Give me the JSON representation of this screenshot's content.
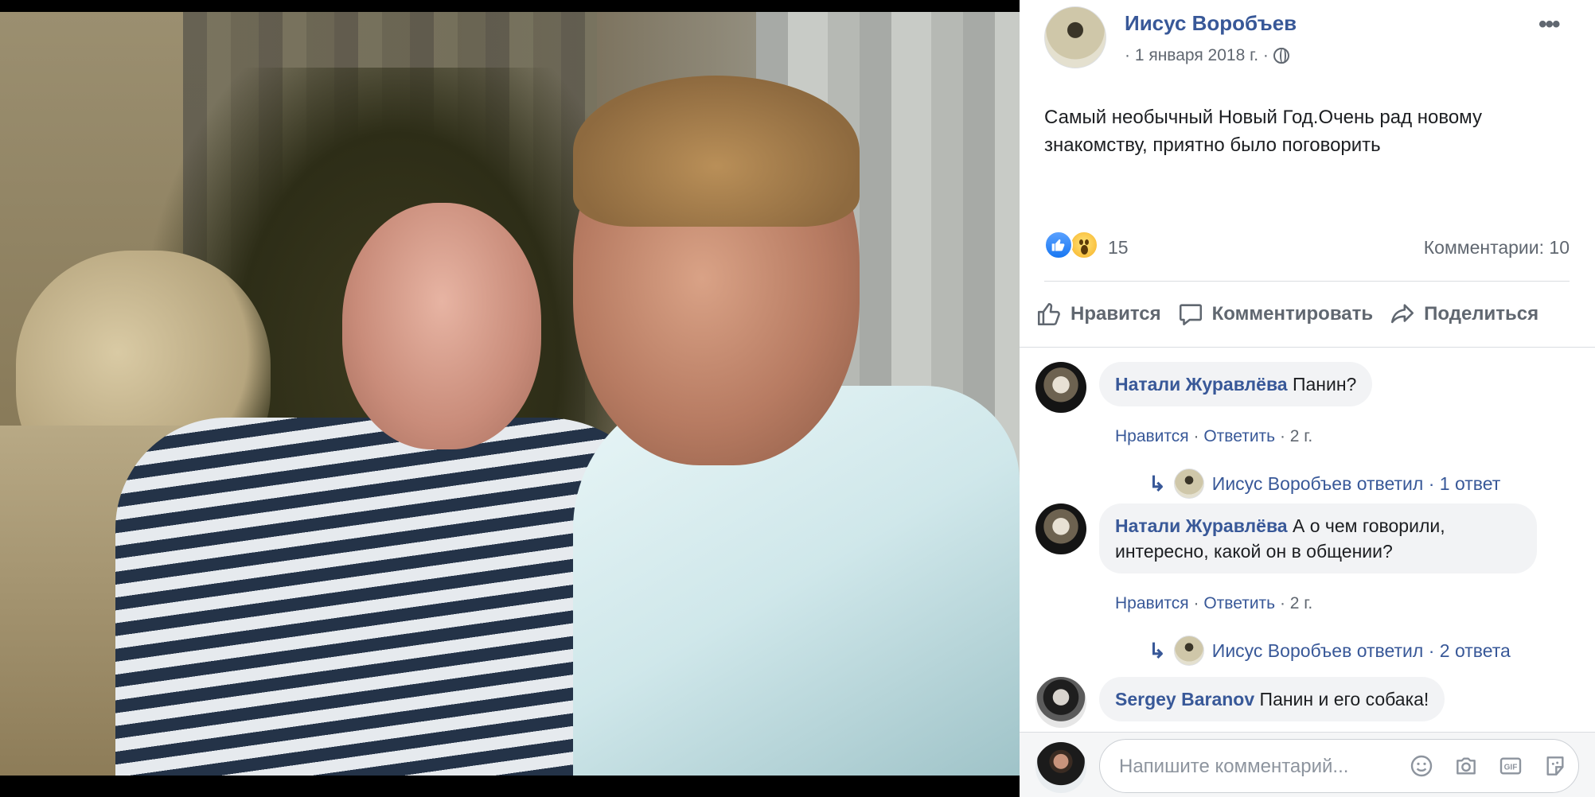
{
  "post": {
    "author": "Иисус Воробъев",
    "date": "· 1 января 2018 г. ·",
    "text": "Самый необычный Новый Год.Очень рад новому знакомству, приятно было поговорить",
    "reactions_count": "15",
    "comments_count": "Комментарии: 10",
    "more_label": "•••"
  },
  "actions": {
    "like": "Нравится",
    "comment": "Комментировать",
    "share": "Поделиться"
  },
  "comments": [
    {
      "author": "Натали Журавлёва",
      "text": "Панин?",
      "like": "Нравится",
      "reply": "Ответить",
      "time": "2 г.",
      "replies_link": "Иисус Воробъев ответил · 1 ответ"
    },
    {
      "author": "Натали Журавлёва",
      "text": "А о чем говорили,",
      "text2": "интересно, какой он в общении?",
      "like": "Нравится",
      "reply": "Ответить",
      "time": "2 г.",
      "replies_link": "Иисус Воробъев ответил · 2 ответа"
    },
    {
      "author": "Sergey Baranov",
      "text": "Панин и его собака!"
    }
  ],
  "composer": {
    "placeholder": "Напишите комментарий..."
  },
  "icons": [
    "globe-icon",
    "more-icon",
    "like-reaction-icon",
    "wow-reaction-icon",
    "thumbs-up-icon",
    "comment-icon",
    "share-icon",
    "reply-arrow-icon",
    "emoji-icon",
    "camera-icon",
    "gif-icon",
    "sticker-icon"
  ],
  "colors": {
    "link": "#385898",
    "meta": "#606770",
    "like_blue": "#1877f2",
    "bubble": "#f2f3f5"
  }
}
